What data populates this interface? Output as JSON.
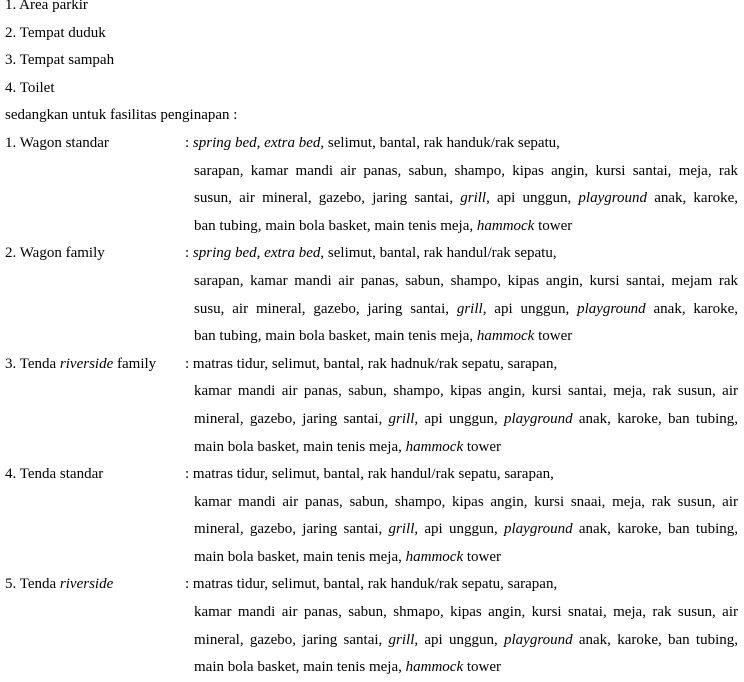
{
  "general_facilities": [
    "1. Area parkir",
    "2. Tempat duduk",
    "3. Tempat sampah",
    "4. Toilet"
  ],
  "intro": "sedangkan untuk fasilitas penginapan  :",
  "accommodations": [
    {
      "term": [
        {
          "t": "1. Wagon standar"
        }
      ],
      "lines": [
        [
          {
            "t": ": "
          },
          {
            "t": "spring bed",
            "i": true
          },
          {
            "t": ", "
          },
          {
            "t": "extra bed",
            "i": true
          },
          {
            "t": ", selimut, bantal, rak handuk/rak sepatu,"
          }
        ],
        [
          {
            "t": "sarapan, kamar mandi air panas, sabun, shampo, kipas angin, kursi santai, meja, rak"
          }
        ],
        [
          {
            "t": "susun, air mineral, gazebo, jaring santai, "
          },
          {
            "t": "grill",
            "i": true
          },
          {
            "t": ", api unggun, "
          },
          {
            "t": "playground",
            "i": true
          },
          {
            "t": " anak, karoke,"
          }
        ],
        [
          {
            "t": "ban tubing, main bola basket, main tenis meja, "
          },
          {
            "t": "hammock",
            "i": true
          },
          {
            "t": " tower"
          }
        ]
      ]
    },
    {
      "term": [
        {
          "t": "2. Wagon family"
        }
      ],
      "lines": [
        [
          {
            "t": ": "
          },
          {
            "t": "spring bed",
            "i": true
          },
          {
            "t": ", "
          },
          {
            "t": "extra bed",
            "i": true
          },
          {
            "t": ", selimut, bantal, rak handul/rak sepatu,"
          }
        ],
        [
          {
            "t": "sarapan, kamar mandi air panas, sabun, shampo, kipas angin, kursi santai, mejam rak"
          }
        ],
        [
          {
            "t": "susu, air mineral, gazebo, jaring santai, "
          },
          {
            "t": "grill",
            "i": true
          },
          {
            "t": ", api unggun, "
          },
          {
            "t": "playground",
            "i": true
          },
          {
            "t": " anak, karoke,"
          }
        ],
        [
          {
            "t": "ban tubing, main bola basket, main tenis meja, "
          },
          {
            "t": "hammock",
            "i": true
          },
          {
            "t": " tower"
          }
        ]
      ]
    },
    {
      "term": [
        {
          "t": "3. Tenda "
        },
        {
          "t": "riverside",
          "i": true
        },
        {
          "t": " family"
        }
      ],
      "lines": [
        [
          {
            "t": ": matras tidur, selimut, bantal, rak hadnuk/rak sepatu, sarapan,"
          }
        ],
        [
          {
            "t": "kamar mandi air panas, sabun, shampo, kipas angin, kursi santai, meja, rak susun, air"
          }
        ],
        [
          {
            "t": "mineral, gazebo, jaring santai, "
          },
          {
            "t": "grill",
            "i": true
          },
          {
            "t": ", api unggun, "
          },
          {
            "t": "playground",
            "i": true
          },
          {
            "t": " anak, karoke, ban tubing,"
          }
        ],
        [
          {
            "t": "main bola basket, main tenis meja, "
          },
          {
            "t": "hammock",
            "i": true
          },
          {
            "t": " tower"
          }
        ]
      ]
    },
    {
      "term": [
        {
          "t": "4. Tenda standar"
        }
      ],
      "lines": [
        [
          {
            "t": ":  matras tidur, selimut, bantal, rak handul/rak sepatu, sarapan,"
          }
        ],
        [
          {
            "t": "kamar mandi air panas, sabun, shampo, kipas angin, kursi snaai, meja, rak susun, air"
          }
        ],
        [
          {
            "t": "mineral, gazebo, jaring santai, "
          },
          {
            "t": "grill",
            "i": true
          },
          {
            "t": ", api unggun, "
          },
          {
            "t": "playground",
            "i": true
          },
          {
            "t": " anak, karoke, ban tubing,"
          }
        ],
        [
          {
            "t": "main bola basket, main tenis meja, "
          },
          {
            "t": "hammock",
            "i": true
          },
          {
            "t": " tower"
          }
        ]
      ]
    },
    {
      "term": [
        {
          "t": "5. Tenda "
        },
        {
          "t": "riverside",
          "i": true
        }
      ],
      "lines": [
        [
          {
            "t": ": matras tidur, selimut, bantal, rak handuk/rak sepatu, sarapan,"
          }
        ],
        [
          {
            "t": "kamar mandi air panas, sabun, shmapo, kipas angin, kursi snatai, meja, rak susun, air"
          }
        ],
        [
          {
            "t": "mineral, gazebo, jaring santai, "
          },
          {
            "t": "grill",
            "i": true
          },
          {
            "t": ", api unggun, "
          },
          {
            "t": "playground",
            "i": true
          },
          {
            "t": " anak, karoke, ban tubing,"
          }
        ],
        [
          {
            "t": "main bola basket, main tenis meja, "
          },
          {
            "t": "hammock",
            "i": true
          },
          {
            "t": " tower"
          }
        ]
      ]
    }
  ]
}
